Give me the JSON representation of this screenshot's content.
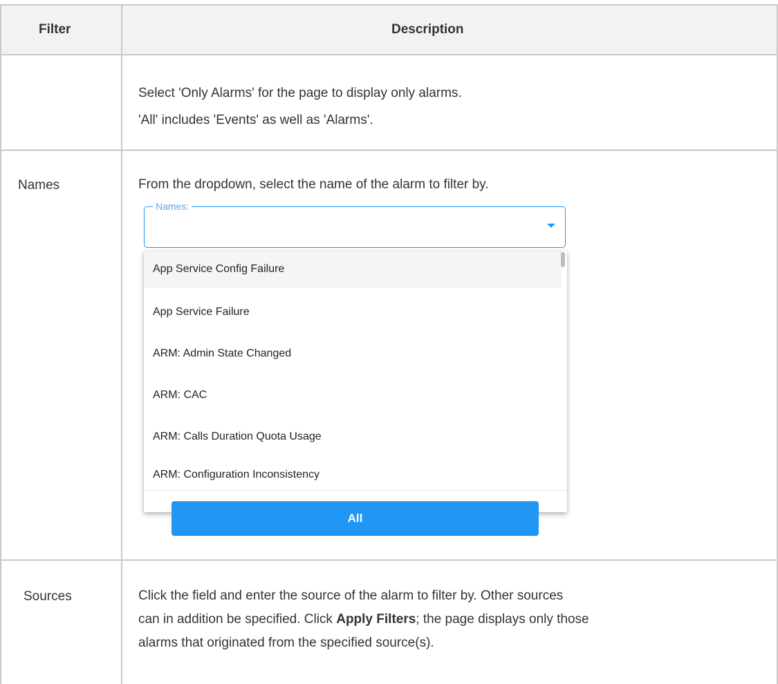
{
  "header": {
    "filter_col": "Filter",
    "description_col": "Description"
  },
  "rows": [
    {
      "filter": "",
      "lines": [
        "Select 'Only Alarms' for the page to display only alarms.",
        "'All' includes 'Events' as well as 'Alarms'."
      ]
    },
    {
      "filter": "Names",
      "intro": "From the dropdown, select the name of the alarm to filter by.",
      "names_field": {
        "legend": "Names:"
      },
      "dropdown_options": [
        "App Service Config Failure",
        "App Service Failure",
        "ARM: Admin State Changed",
        "ARM: CAC",
        "ARM: Calls Duration Quota Usage",
        "ARM: Configuration Inconsistency"
      ],
      "all_button": "All"
    },
    {
      "filter": "Sources",
      "lines": [
        "Click the field and enter the source of the alarm to filter by. Other sources",
        "can in addition be specified. Click ",
        "Apply Filters",
        "; the page displays only those",
        "alarms that originated from the specified source(s)."
      ]
    }
  ],
  "colors": {
    "header_bg": "#f2f2f2",
    "border": "#c8c8c8",
    "accent": "#2196f3"
  }
}
